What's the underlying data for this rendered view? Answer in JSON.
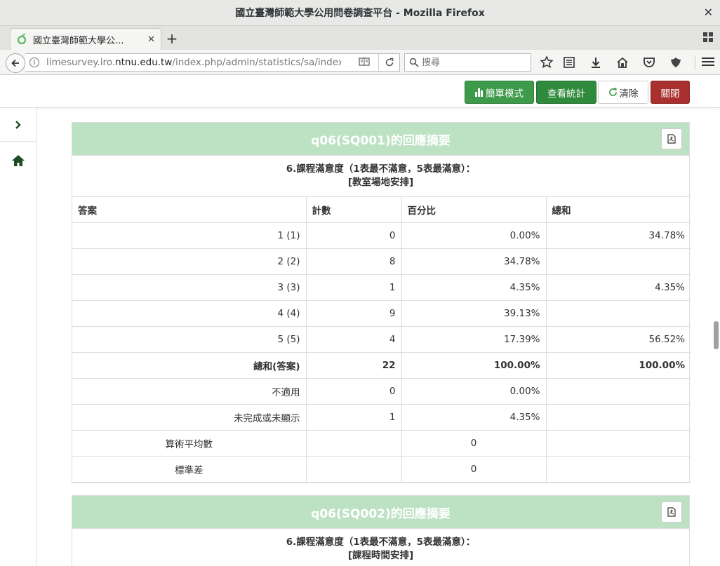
{
  "window": {
    "title": "國立臺灣師範大學公用問卷調查平台 - Mozilla Firefox",
    "close": "✕"
  },
  "tab": {
    "label": "國立臺灣師範大學公...",
    "close": "✕",
    "new": "+"
  },
  "nav": {
    "url_pre": "limesurvey.iro.",
    "url_host": "ntnu.edu.tw",
    "url_post": "/index.php/admin/statistics/sa/index/su",
    "search_placeholder": "搜尋"
  },
  "toolbar": {
    "simple_mode": "簡單模式",
    "view_stats": "查看統計",
    "clear": "清除",
    "close": "關閉"
  },
  "colors": {
    "green": "#3c9a4a",
    "red": "#a8302e",
    "panel_head": "#bde2c3"
  },
  "panels": [
    {
      "title": "q06(SQ001)的回應摘要",
      "question_line1": "6.課程滿意度（1表最不滿意，5表最滿意）：",
      "question_line2": "[教室場地安排]",
      "headers": [
        "答案",
        "計數",
        "百分比",
        "總和"
      ],
      "rows": [
        {
          "answer": "1 (1)",
          "count": "0",
          "pct": "0.00%",
          "sum": "34.78%"
        },
        {
          "answer": "2 (2)",
          "count": "8",
          "pct": "34.78%",
          "sum": ""
        },
        {
          "answer": "3 (3)",
          "count": "1",
          "pct": "4.35%",
          "sum": "4.35%"
        },
        {
          "answer": "4 (4)",
          "count": "9",
          "pct": "39.13%",
          "sum": ""
        },
        {
          "answer": "5 (5)",
          "count": "4",
          "pct": "17.39%",
          "sum": "56.52%"
        }
      ],
      "total": {
        "answer": "總和(答案)",
        "count": "22",
        "pct": "100.00%",
        "sum": "100.00%"
      },
      "na": {
        "answer": "不適用",
        "count": "0",
        "pct": "0.00%"
      },
      "incomplete": {
        "answer": "未完成或未顯示",
        "count": "1",
        "pct": "4.35%"
      },
      "mean": {
        "label": "算術平均數",
        "value": "0"
      },
      "stddev": {
        "label": "標準差",
        "value": "0"
      }
    },
    {
      "title": "q06(SQ002)的回應摘要",
      "question_line1": "6.課程滿意度（1表最不滿意，5表最滿意）：",
      "question_line2": "[課程時間安排]"
    }
  ]
}
